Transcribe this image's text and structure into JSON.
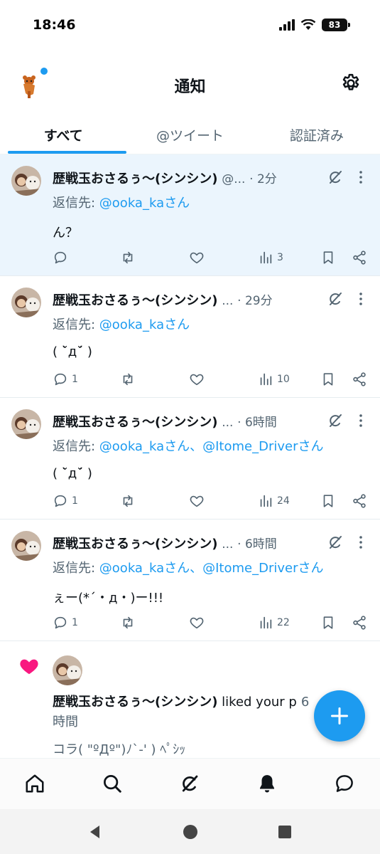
{
  "status_bar": {
    "time": "18:46",
    "battery": "83"
  },
  "header": {
    "title": "通知"
  },
  "tabs": [
    {
      "label": "すべて",
      "active": true
    },
    {
      "label": "@ツイート",
      "active": false
    },
    {
      "label": "認証済み",
      "active": false
    }
  ],
  "notifications": [
    {
      "name": "歴戦玉おさるぅ〜(シンシン)",
      "handle": "@...",
      "time": "· 2分",
      "reply_prefix": "返信先: ",
      "mentions": [
        "@ooka_kaさん"
      ],
      "text": "ん？",
      "reply_count": "",
      "view_count": "3",
      "highlight": true
    },
    {
      "name": "歴戦玉おさるぅ〜(シンシン)",
      "handle": "...",
      "time": "· 29分",
      "reply_prefix": "返信先: ",
      "mentions": [
        "@ooka_kaさん"
      ],
      "text": "( ˘̀д˘́ )",
      "reply_count": "1",
      "view_count": "10",
      "highlight": false
    },
    {
      "name": "歴戦玉おさるぅ〜(シンシン)",
      "handle": "...",
      "time": "· 6時間",
      "reply_prefix": "返信先: ",
      "mentions": [
        "@ooka_kaさん、",
        "@Itome_Driverさん"
      ],
      "text": "( ˘̀д˘́ )",
      "reply_count": "1",
      "view_count": "24",
      "highlight": false
    },
    {
      "name": "歴戦玉おさるぅ〜(シンシン)",
      "handle": "...",
      "time": "· 6時間",
      "reply_prefix": "返信先: ",
      "mentions": [
        "@ooka_kaさん、",
        "@Itome_Driverさん"
      ],
      "text": "ぇー(*´・д・)ー!!!",
      "reply_count": "1",
      "view_count": "22",
      "highlight": false
    }
  ],
  "like_notification": {
    "name": "歴戦玉おさるぅ〜(シンシン)",
    "action": " liked your p",
    "time_suffix": "6",
    "time_line": "時間",
    "text": "コラ( \"ºДº\")ﾉ`-' ) ﾍﾟｼｯ"
  },
  "colors": {
    "accent": "#1d9bf0",
    "like": "#f91880",
    "text": "#0f1419",
    "muted": "#536471",
    "highlight_bg": "#ebf5fd"
  },
  "icons": {
    "reply": "speech-bubble-icon",
    "retweet": "retweet-icon",
    "like": "heart-icon",
    "views": "bar-chart-icon",
    "bookmark": "bookmark-icon",
    "share": "share-icon",
    "grok": "grok-icon",
    "more": "more-vertical-icon"
  },
  "bottom_nav": [
    "home-icon",
    "search-icon",
    "grok-icon",
    "notifications-icon",
    "messages-icon"
  ]
}
